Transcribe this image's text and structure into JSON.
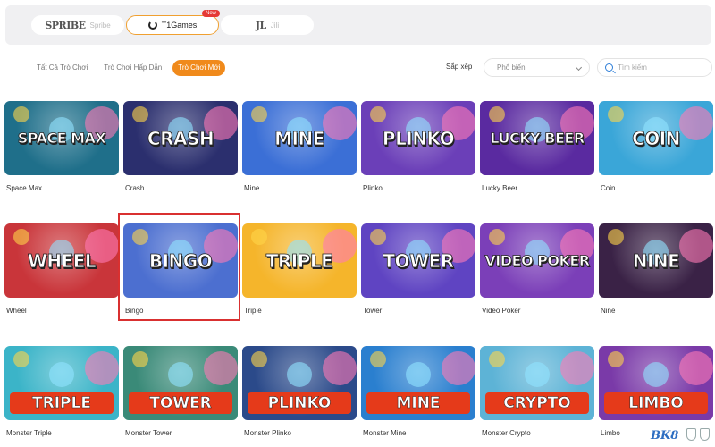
{
  "providers": [
    {
      "logo": "SPRIBE",
      "label": "Spribe"
    },
    {
      "logo": "",
      "label": "T1Games",
      "badge": "New"
    },
    {
      "logo": "JL",
      "label": "Jili"
    }
  ],
  "tabs": [
    "Tất Cả Trò Chơi",
    "Trò Chơi Hấp Dẫn",
    "Trò Chơi Mới"
  ],
  "sort": {
    "label": "Sắp xếp",
    "value": "Phổ biến"
  },
  "search": {
    "placeholder": "Tìm kiếm"
  },
  "games": [
    {
      "name": "Space Max",
      "art": "SPACE MAX",
      "bg": "#1f6f8a"
    },
    {
      "name": "Crash",
      "art": "CRASH",
      "bg": "#2b2f6e"
    },
    {
      "name": "Mine",
      "art": "MINE",
      "bg": "#3b6fd6"
    },
    {
      "name": "Plinko",
      "art": "PLINKO",
      "bg": "#6b3fb8"
    },
    {
      "name": "Lucky Beer",
      "art": "LUCKY BEER",
      "bg": "#5a2aa0"
    },
    {
      "name": "Coin",
      "art": "COIN",
      "bg": "#3aa6d8"
    },
    {
      "name": "Wheel",
      "art": "WHEEL",
      "bg": "#c9353a"
    },
    {
      "name": "Bingo",
      "art": "BINGO",
      "bg": "#4c6fd0"
    },
    {
      "name": "Triple",
      "art": "TRIPLE",
      "bg": "#f5b52b"
    },
    {
      "name": "Tower",
      "art": "TOWER",
      "bg": "#5f44c2"
    },
    {
      "name": "Video Poker",
      "art": "VIDEO POKER",
      "bg": "#7b3fb8"
    },
    {
      "name": "Nine",
      "art": "NINE",
      "bg": "#3a2246"
    },
    {
      "name": "Monster Triple",
      "art": "TRIPLE",
      "bg": "#3bb4c8"
    },
    {
      "name": "Monster Tower",
      "art": "TOWER",
      "bg": "#3a8a78"
    },
    {
      "name": "Monster Plinko",
      "art": "PLINKO",
      "bg": "#2b4a8a"
    },
    {
      "name": "Monster Mine",
      "art": "MINE",
      "bg": "#2a7fcf"
    },
    {
      "name": "Monster Crypto",
      "art": "CRYPTO",
      "bg": "#5db3d6"
    },
    {
      "name": "Limbo",
      "art": "LIMBO",
      "bg": "#7a3aa8"
    }
  ],
  "footer": {
    "brand": "BK8"
  },
  "colors": {
    "accent": "#f08a1c",
    "highlight": "#d93030"
  }
}
